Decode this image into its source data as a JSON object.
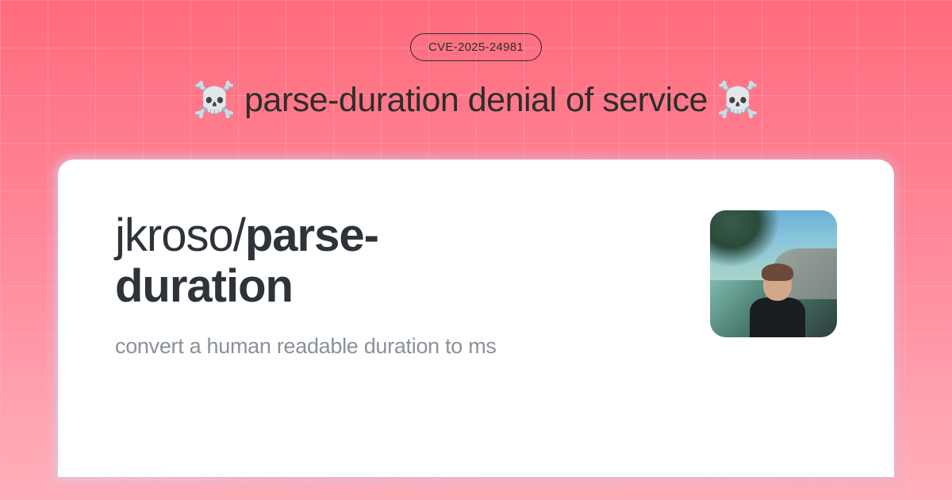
{
  "cve_id": "CVE-2025-24981",
  "title": "☠️ parse-duration denial of service ☠️",
  "repo": {
    "owner": "jkroso",
    "separator": "/",
    "name_part1": "parse",
    "hyphen": "-",
    "name_part2": "duration",
    "description": "convert a human readable duration to ms"
  }
}
